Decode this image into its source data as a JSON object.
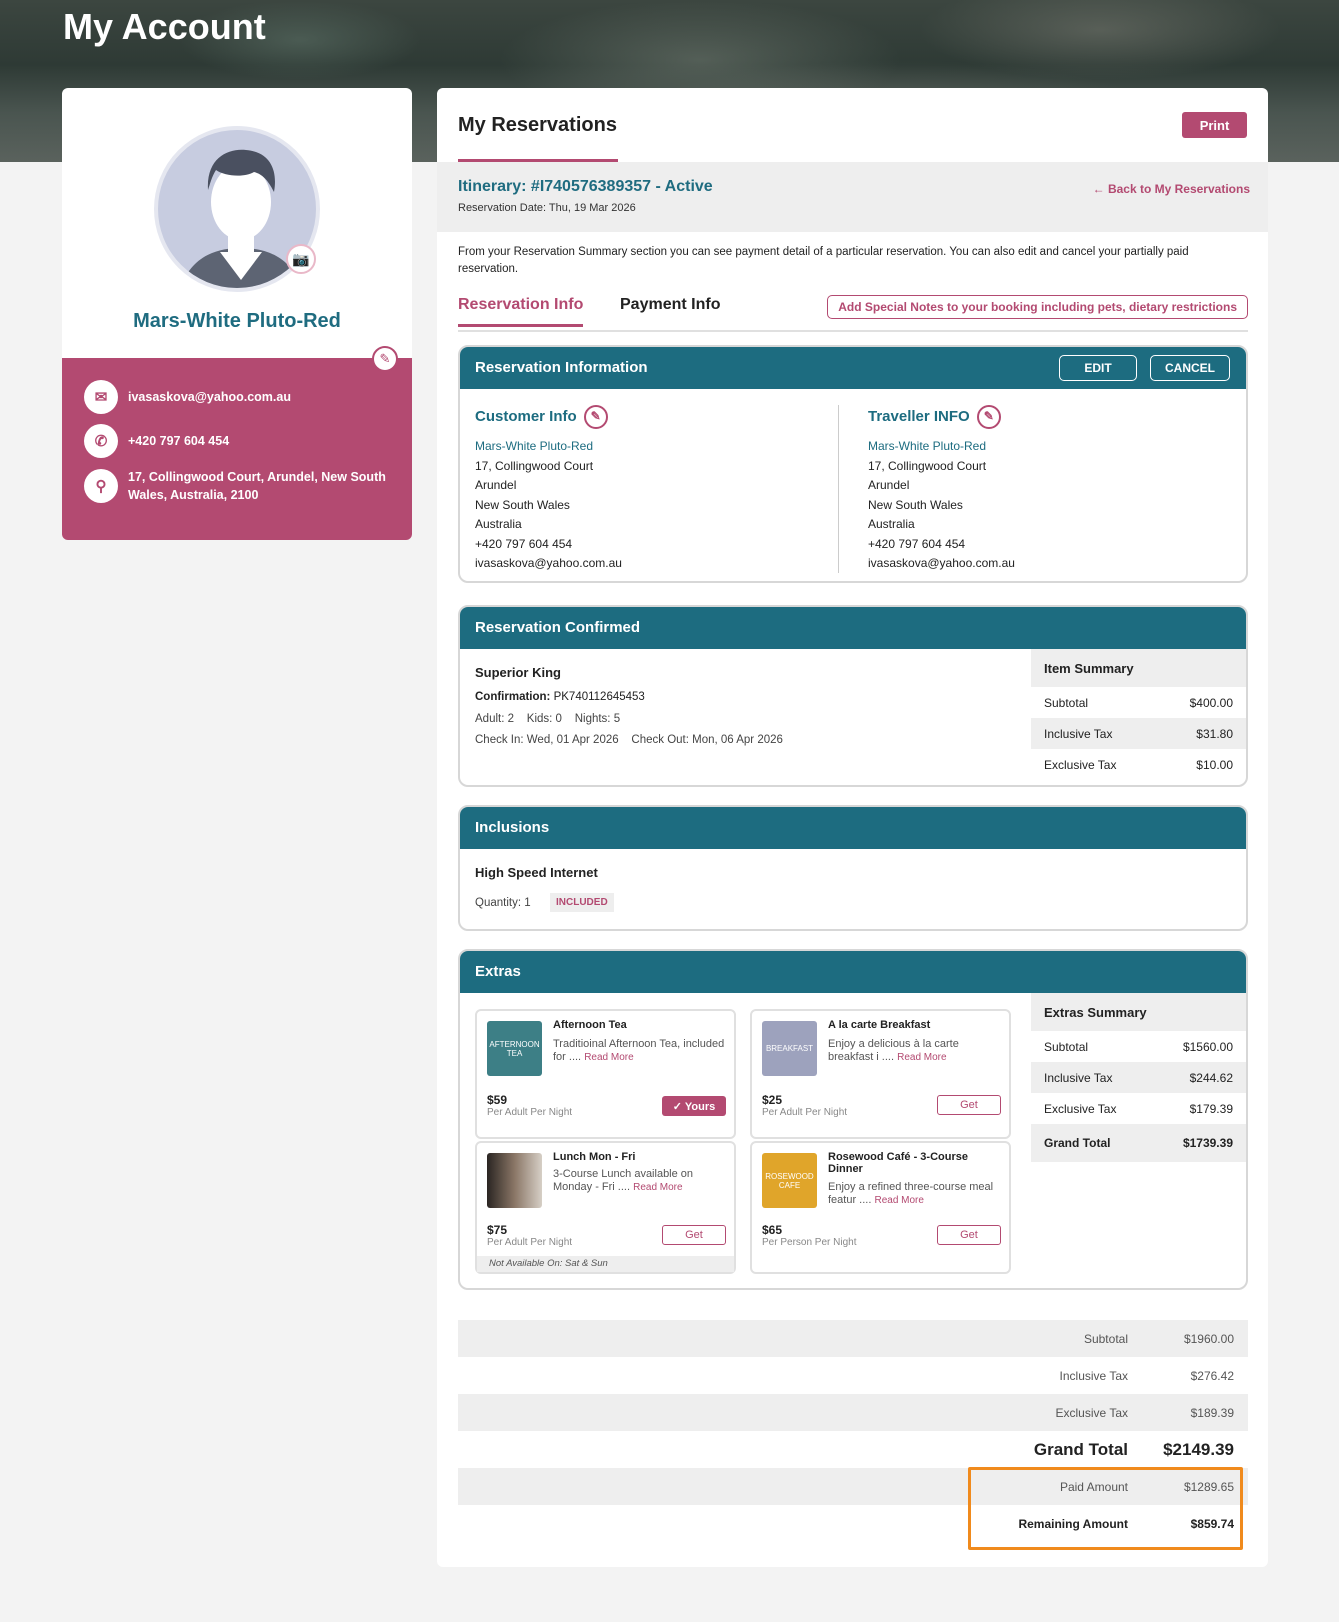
{
  "page": {
    "title": "My Account"
  },
  "profile": {
    "name": "Mars-White Pluto-Red",
    "email": "ivasaskova@yahoo.com.au",
    "phone": "+420 797 604 454",
    "address": "17, Collingwood Court, Arundel, New South Wales, Australia, 2100"
  },
  "reservations": {
    "title": "My Reservations",
    "print_label": "Print",
    "itinerary": "Itinerary: #I740576389357 - Active",
    "reservation_date": "Reservation Date: Thu, 19 Mar 2026",
    "back_label": "Back to My Reservations",
    "intro": "From your Reservation Summary section you can see payment detail of a particular reservation. You can also edit and cancel your partially paid reservation.",
    "tabs": [
      "Reservation Info",
      "Payment Info"
    ],
    "special_notes_label": "Add Special Notes to your booking including pets, dietary restrictions"
  },
  "reservation_info": {
    "title": "Reservation Information",
    "edit_label": "EDIT",
    "cancel_label": "CANCEL",
    "customer": {
      "heading": "Customer Info",
      "lines": [
        "Mars-White Pluto-Red",
        "17, Collingwood Court",
        "Arundel",
        "New South Wales",
        "Australia",
        "+420 797 604 454",
        "ivasaskova@yahoo.com.au"
      ]
    },
    "traveller": {
      "heading": "Traveller INFO",
      "lines": [
        "Mars-White Pluto-Red",
        "17, Collingwood Court",
        "Arundel",
        "New South Wales",
        "Australia",
        "+420 797 604 454",
        "ivasaskova@yahoo.com.au"
      ]
    }
  },
  "confirmed": {
    "title": "Reservation Confirmed",
    "room": "Superior King",
    "confirmation_label": "Confirmation:",
    "confirmation_value": "PK740112645453",
    "occupancy": "Adult: 2    Kids: 0    Nights: 5",
    "dates": "Check In: Wed, 01 Apr 2026    Check Out: Mon, 06 Apr 2026",
    "summary": {
      "heading": "Item Summary",
      "rows": [
        {
          "label": "Subtotal",
          "value": "$400.00"
        },
        {
          "label": "Inclusive Tax",
          "value": "$31.80"
        },
        {
          "label": "Exclusive Tax",
          "value": "$10.00"
        }
      ]
    }
  },
  "inclusions": {
    "title": "Inclusions",
    "item": "High Speed Internet",
    "quantity": "Quantity: 1",
    "badge": "INCLUDED"
  },
  "extras": {
    "title": "Extras",
    "items": [
      {
        "title": "Afternoon Tea",
        "desc": "Traditioinal Afternoon Tea, included for ....",
        "read_more": "Read More",
        "price": "$59",
        "per": "Per Adult Per Night",
        "action": "Yours",
        "thumb": "AFTERNOON TEA",
        "thumb_color": "#3d7f86"
      },
      {
        "title": "A la carte Breakfast",
        "desc": "Enjoy a delicious à la carte breakfast i ....",
        "read_more": "Read More",
        "price": "$25",
        "per": "Per Adult Per Night",
        "action": "Get",
        "thumb": "BREAKFAST",
        "thumb_color": "#9da2bd"
      },
      {
        "title": "Lunch Mon - Fri",
        "desc": "3-Course Lunch available on Monday - Fri ....",
        "read_more": "Read More",
        "price": "$75",
        "per": "Per Adult Per Night",
        "action": "Get",
        "note": "Not Available On: Sat & Sun",
        "thumb": "",
        "thumb_color": "#5a4a42"
      },
      {
        "title": "Rosewood Café - 3-Course Dinner",
        "desc": "Enjoy a refined three-course meal featur ....",
        "read_more": "Read More",
        "price": "$65",
        "per": "Per Person Per Night",
        "action": "Get",
        "thumb": "ROSEWOOD CAFE",
        "thumb_color": "#e0a52a"
      }
    ],
    "summary": {
      "heading": "Extras Summary",
      "rows": [
        {
          "label": "Subtotal",
          "value": "$1560.00"
        },
        {
          "label": "Inclusive Tax",
          "value": "$244.62"
        },
        {
          "label": "Exclusive Tax",
          "value": "$179.39"
        },
        {
          "label": "Grand Total",
          "value": "$1739.39"
        }
      ]
    }
  },
  "totals": {
    "subtotal": {
      "label": "Subtotal",
      "value": "$1960.00"
    },
    "inclusive_tax": {
      "label": "Inclusive Tax",
      "value": "$276.42"
    },
    "exclusive_tax": {
      "label": "Exclusive Tax",
      "value": "$189.39"
    },
    "grand_total": {
      "label": "Grand Total",
      "value": "$2149.39"
    },
    "paid": {
      "label": "Paid Amount",
      "value": "$1289.65"
    },
    "remaining": {
      "label": "Remaining Amount",
      "value": "$859.74"
    }
  },
  "colors": {
    "accent": "#b34a71",
    "teal": "#1d6c80",
    "highlight": "#f08a1c"
  }
}
